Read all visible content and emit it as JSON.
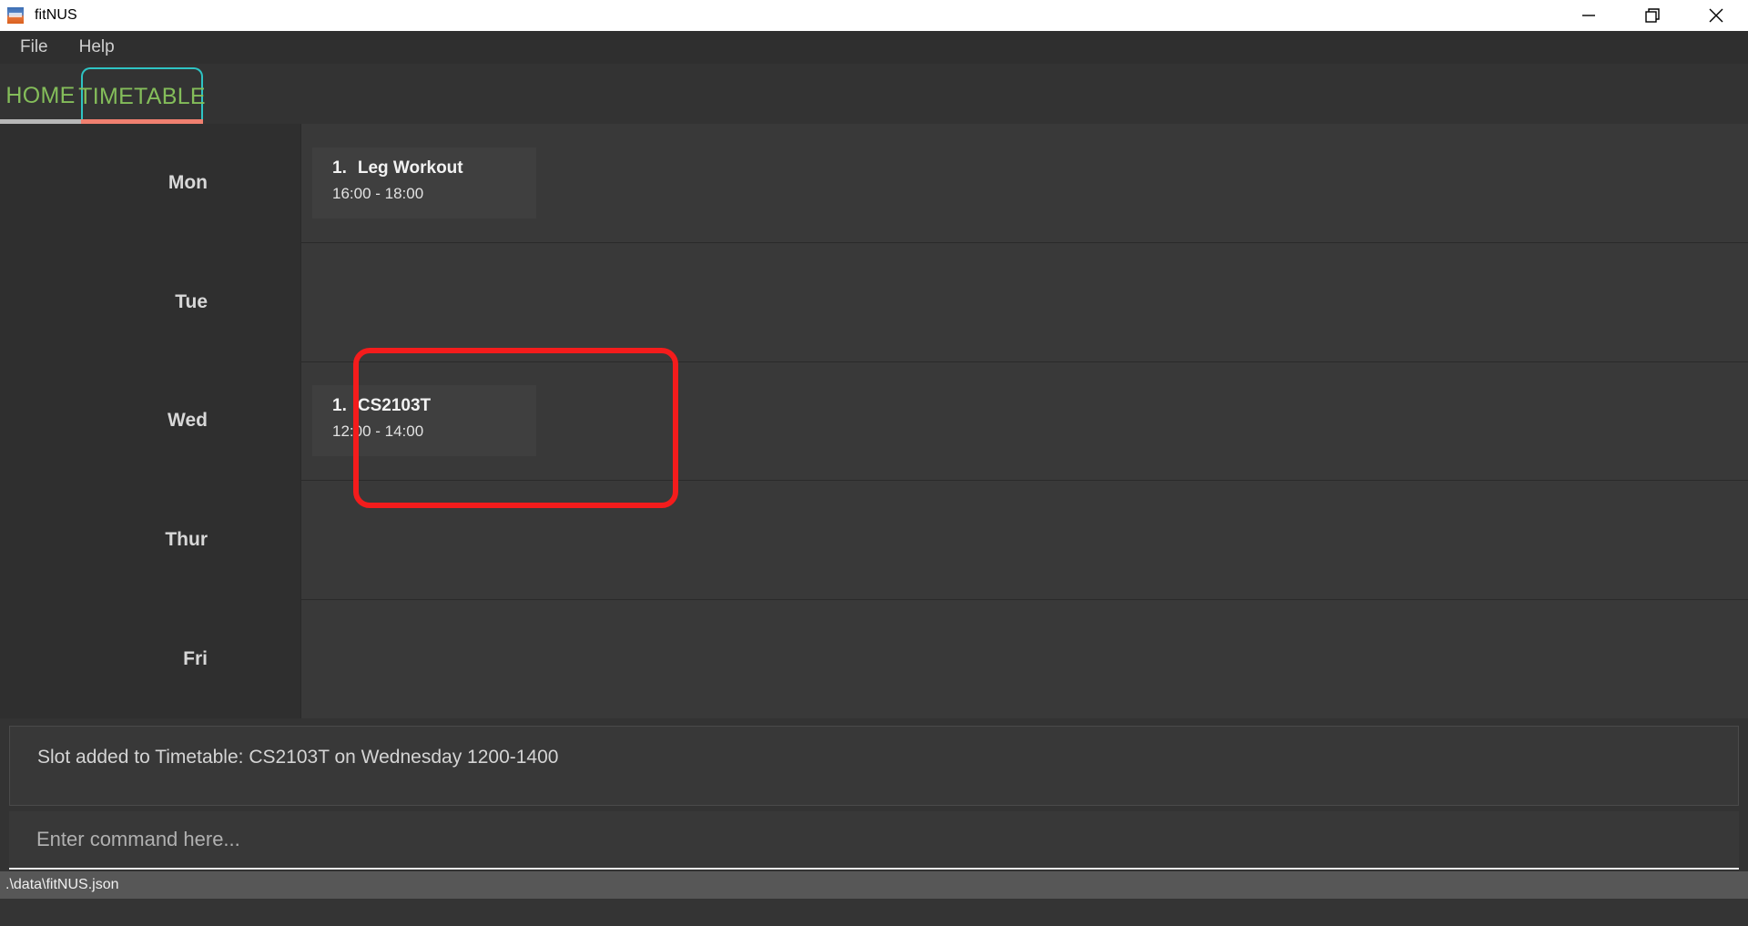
{
  "window": {
    "title": "fitNUS",
    "icon": "app-logo-icon",
    "controls": [
      {
        "name": "minimize-button",
        "glyph": "minimize-icon"
      },
      {
        "name": "restore-button",
        "glyph": "restore-icon"
      },
      {
        "name": "close-button",
        "glyph": "close-icon"
      }
    ]
  },
  "menubar": {
    "items": [
      {
        "label": "File"
      },
      {
        "label": "Help"
      }
    ]
  },
  "tabs": {
    "items": [
      {
        "label": "HOME",
        "selected": false,
        "underline_color": "#b7b7b7"
      },
      {
        "label": "TIMETABLE",
        "selected": true,
        "underline_color": "#f08070",
        "focus_border_color": "#2ec4c4"
      }
    ],
    "label_color": "#84bd5a"
  },
  "timetable": {
    "days": [
      {
        "label": "Mon",
        "slots": [
          {
            "index": "1.",
            "name": "Leg Workout",
            "time": "16:00 - 18:00"
          }
        ]
      },
      {
        "label": "Tue",
        "slots": []
      },
      {
        "label": "Wed",
        "slots": [
          {
            "index": "1.",
            "name": "CS2103T",
            "time": "12:00 - 14:00"
          }
        ]
      },
      {
        "label": "Thur",
        "slots": []
      },
      {
        "label": "Fri",
        "slots": []
      }
    ],
    "highlight": {
      "name": "wednesday-row-highlight",
      "color": "#f41c1c"
    }
  },
  "result_display": {
    "text": "Slot added to Timetable: CS2103T on Wednesday 1200-1400"
  },
  "command_box": {
    "value": "",
    "placeholder": "Enter command here..."
  },
  "status_bar": {
    "text": ".\\data\\fitNUS.json"
  }
}
